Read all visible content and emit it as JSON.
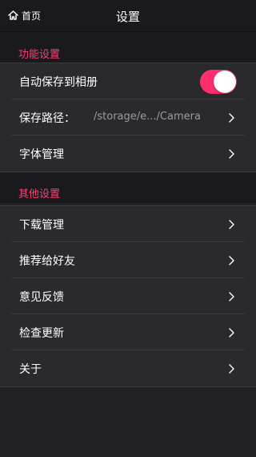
{
  "header": {
    "back_label": "首页",
    "title": "设置",
    "back_icon": "home-icon"
  },
  "sections": {
    "function": {
      "title": "功能设置",
      "auto_save": {
        "label": "自动保存到相册",
        "enabled": true
      },
      "save_path": {
        "label": "保存路径：",
        "value": "/storage/e.../Camera"
      },
      "font_manage": {
        "label": "字体管理"
      }
    },
    "other": {
      "title": "其他设置",
      "items": [
        {
          "label": "下载管理"
        },
        {
          "label": "推荐给好友"
        },
        {
          "label": "意见反馈"
        },
        {
          "label": "检查更新"
        },
        {
          "label": "关于"
        }
      ]
    }
  },
  "colors": {
    "accent": "#ff3d74",
    "toggle_on": "#ff2f6e",
    "background": "#222226",
    "row_background": "#2a2a2e",
    "header_background": "#1a1a1e",
    "secondary_text": "#9a9aa0"
  }
}
